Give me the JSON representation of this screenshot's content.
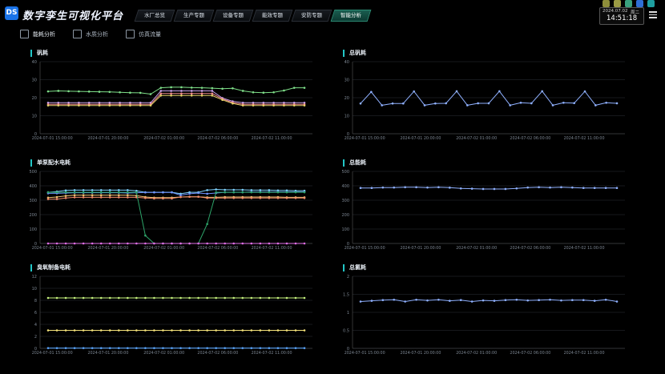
{
  "app": {
    "title": "数字孪生可视化平台",
    "logo_text": "DS"
  },
  "nav": {
    "tabs": [
      "水厂总览",
      "生产专题",
      "设备专题",
      "能效专题",
      "安防专题",
      "智能分析"
    ],
    "active": 5
  },
  "header": {
    "date": "2024.07.02",
    "weekday": "周二",
    "time": "14:51:18",
    "icons": [
      {
        "name": "power-icon",
        "color": "#8e8e3a"
      },
      {
        "name": "module-icon",
        "color": "#9a9a44"
      },
      {
        "name": "app-icon",
        "color": "#3aa17e"
      },
      {
        "name": "app-icon",
        "color": "#2f6fd6"
      },
      {
        "name": "app-icon",
        "color": "#1e9fa0"
      }
    ]
  },
  "subtabs": [
    {
      "label": "能耗分析",
      "active": true
    },
    {
      "label": "水质分析",
      "active": false
    },
    {
      "label": "仿真流量",
      "active": false
    }
  ],
  "colors": {
    "accent": "#22c6c6",
    "grid": "#2c3139",
    "axis": "#7d8793"
  },
  "xticks": [
    "2024-07-01 15:00:00",
    "2024-07-01 20:00:00",
    "2024-07-02 01:00:00",
    "2024-07-02 06:00:00",
    "2024-07-02 11:00:00"
  ],
  "chart_data": [
    {
      "title": "矾耗",
      "type": "line",
      "ylim": [
        0,
        40
      ],
      "yticks": [
        0,
        10,
        20,
        30,
        40
      ],
      "series": [
        {
          "color": "#7fe08a",
          "values": [
            23.5,
            23.8,
            23.6,
            23.5,
            23.4,
            23.3,
            23.2,
            23,
            22.8,
            22.7,
            22,
            25.5,
            25.8,
            25.8,
            25.6,
            25.5,
            25.3,
            25,
            25.2,
            23.8,
            23,
            22.8,
            23,
            24,
            25.5,
            25.5
          ]
        },
        {
          "color": "#c79fe8",
          "values": [
            17.2,
            17.2,
            17.2,
            17.2,
            17.2,
            17.2,
            17.2,
            17.2,
            17.2,
            17.2,
            17.2,
            23.8,
            23.8,
            23.8,
            23.8,
            23.8,
            23.8,
            19.8,
            18,
            17.2,
            17.2,
            17.2,
            17.2,
            17.2,
            17.2,
            17.2
          ]
        },
        {
          "color": "#f28c8c",
          "values": [
            16.3,
            16.3,
            16.3,
            16.3,
            16.3,
            16.3,
            16.3,
            16.3,
            16.3,
            16.3,
            16.3,
            22.3,
            22.3,
            22.3,
            22.3,
            22.3,
            22.3,
            19.3,
            17.3,
            16.3,
            16.3,
            16.3,
            16.3,
            16.3,
            16.3,
            16.3
          ]
        },
        {
          "color": "#e6d36a",
          "values": [
            15.7,
            15.7,
            15.7,
            15.7,
            15.7,
            15.7,
            15.7,
            15.7,
            15.7,
            15.7,
            15.7,
            21.2,
            21.2,
            21.2,
            21.2,
            21.2,
            21.2,
            18.8,
            16.8,
            15.7,
            15.7,
            15.7,
            15.7,
            15.7,
            15.7,
            15.7
          ]
        }
      ]
    },
    {
      "title": "总矾耗",
      "type": "line",
      "ylim": [
        0,
        40
      ],
      "yticks": [
        0,
        10,
        20,
        30,
        40
      ],
      "series": [
        {
          "color": "#8fb0ff",
          "values": [
            16.8,
            23.2,
            15.8,
            16.8,
            16.8,
            23.5,
            15.8,
            16.8,
            16.9,
            23.6,
            15.8,
            16.9,
            16.9,
            23.6,
            15.8,
            17.2,
            16.9,
            23.6,
            15.8,
            17.2,
            17,
            23.5,
            15.8,
            17.2,
            16.9
          ]
        }
      ]
    },
    {
      "title": "单泵配水电耗",
      "type": "line",
      "ylim": [
        0,
        500
      ],
      "yticks": [
        0,
        100,
        200,
        300,
        400,
        500
      ],
      "series": [
        {
          "color": "#7fd3ff",
          "values": [
            355,
            360,
            368,
            370,
            370,
            370,
            370,
            370,
            370,
            370,
            365,
            355,
            355,
            355,
            355,
            345,
            355,
            355,
            370,
            375,
            372,
            372,
            372,
            370,
            370,
            370,
            368,
            368,
            366,
            366
          ]
        },
        {
          "color": "#6f92ff",
          "values": [
            348,
            348,
            350,
            352,
            352,
            352,
            352,
            352,
            352,
            350,
            352,
            354,
            354,
            354,
            354,
            335,
            345,
            350,
            345,
            350,
            355,
            355,
            355,
            358,
            358,
            358,
            358,
            358,
            358,
            358
          ]
        },
        {
          "color": "#f0c070",
          "values": [
            318,
            322,
            330,
            335,
            335,
            335,
            335,
            335,
            335,
            335,
            332,
            322,
            318,
            318,
            318,
            322,
            324,
            324,
            320,
            320,
            322,
            322,
            322,
            322,
            322,
            322,
            322,
            320,
            320,
            320
          ]
        },
        {
          "color": "#f08a6a",
          "values": [
            308,
            308,
            315,
            320,
            320,
            320,
            320,
            320,
            320,
            320,
            320,
            315,
            312,
            312,
            312,
            322,
            324,
            324,
            315,
            315,
            315,
            315,
            315,
            315,
            315,
            315,
            315,
            315,
            315,
            315
          ]
        },
        {
          "color": "#2ea56a",
          "values": [
            355,
            355,
            355,
            355,
            355,
            355,
            355,
            355,
            355,
            355,
            355,
            55,
            0,
            0,
            0,
            0,
            0,
            0,
            135,
            355,
            355,
            355,
            355,
            355,
            355,
            355,
            355,
            355,
            355,
            355
          ]
        },
        {
          "color": "#e06fe6",
          "values": [
            0,
            0,
            0,
            0,
            0,
            0,
            0,
            0,
            0,
            0,
            0,
            0,
            0,
            0,
            0,
            0,
            0,
            0,
            0,
            0,
            0,
            0,
            0,
            0,
            0,
            0,
            0,
            0,
            0,
            0
          ]
        }
      ]
    },
    {
      "title": "总能耗",
      "type": "line",
      "ylim": [
        0,
        500
      ],
      "yticks": [
        0,
        100,
        200,
        300,
        400,
        500
      ],
      "series": [
        {
          "color": "#8fb0ff",
          "values": [
            385,
            385,
            388,
            388,
            390,
            390,
            388,
            390,
            387,
            382,
            380,
            378,
            378,
            378,
            382,
            388,
            390,
            388,
            390,
            388,
            385,
            385,
            385,
            385
          ]
        }
      ]
    },
    {
      "title": "臭氧制备电耗",
      "type": "line",
      "ylim": [
        0,
        12
      ],
      "yticks": [
        0,
        2,
        4,
        6,
        8,
        10,
        12
      ],
      "series": [
        {
          "color": "#c6f27e",
          "values": [
            8.4,
            8.4,
            8.4,
            8.4,
            8.4,
            8.4,
            8.4,
            8.4,
            8.4,
            8.4,
            8.4,
            8.4,
            8.4,
            8.4,
            8.4,
            8.4,
            8.4,
            8.4,
            8.4,
            8.4,
            8.4,
            8.4,
            8.4,
            8.4,
            8.4,
            8.4,
            8.4,
            8.4,
            8.4,
            8.4
          ]
        },
        {
          "color": "#f4e27a",
          "values": [
            3,
            3,
            3,
            3,
            3,
            3,
            3,
            3,
            3,
            3,
            3,
            3,
            3,
            3,
            3,
            3,
            3,
            3,
            3,
            3,
            3,
            3,
            3,
            3,
            3,
            3,
            3,
            3,
            3,
            3
          ]
        },
        {
          "color": "#5aa6ff",
          "values": [
            0.05,
            0.05,
            0.05,
            0.05,
            0.05,
            0.05,
            0.05,
            0.05,
            0.05,
            0.05,
            0.05,
            0.05,
            0.05,
            0.05,
            0.05,
            0.05,
            0.05,
            0.05,
            0.05,
            0.05,
            0.05,
            0.05,
            0.05,
            0.05,
            0.05,
            0.05,
            0.05,
            0.05,
            0.05,
            0.05
          ]
        }
      ]
    },
    {
      "title": "总氯耗",
      "type": "line",
      "ylim": [
        0,
        2
      ],
      "yticks": [
        0,
        0.5,
        1,
        1.5,
        2
      ],
      "series": [
        {
          "color": "#8fb0ff",
          "values": [
            1.3,
            1.32,
            1.34,
            1.35,
            1.3,
            1.35,
            1.33,
            1.35,
            1.32,
            1.34,
            1.3,
            1.33,
            1.32,
            1.34,
            1.35,
            1.33,
            1.34,
            1.35,
            1.33,
            1.34,
            1.34,
            1.32,
            1.35,
            1.3
          ]
        }
      ]
    }
  ]
}
